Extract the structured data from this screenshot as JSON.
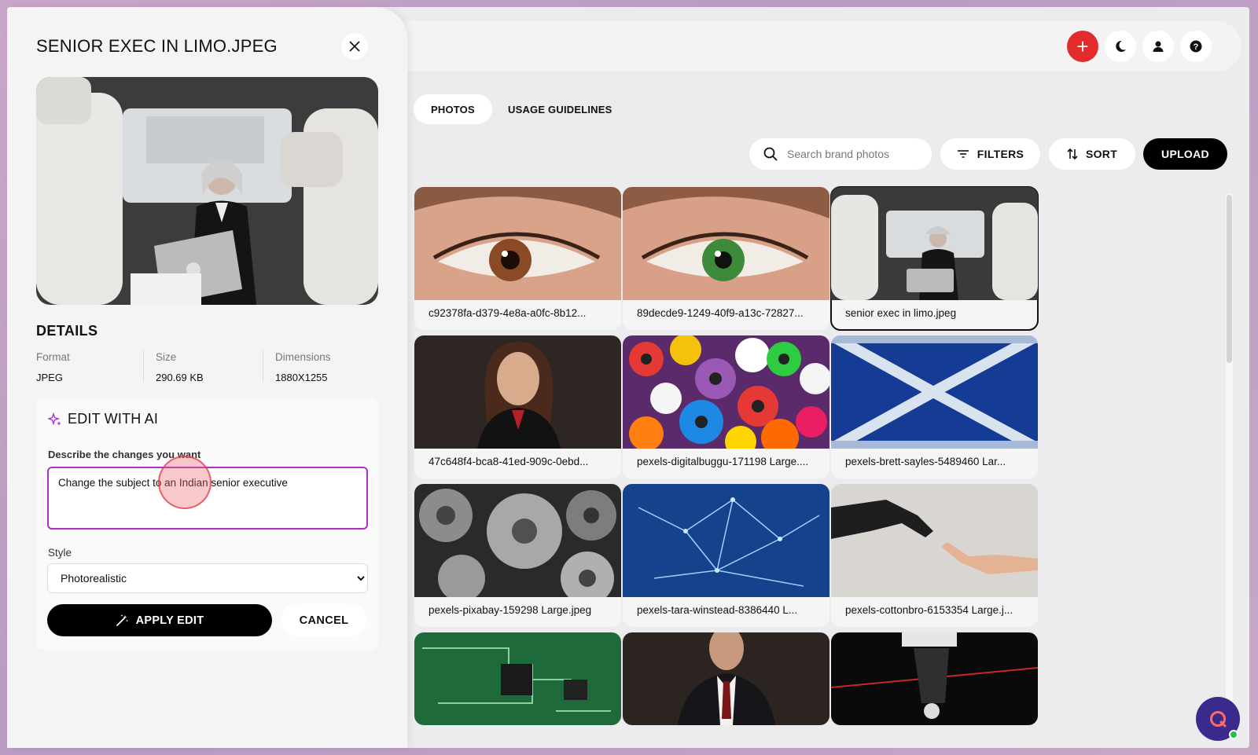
{
  "colors": {
    "accent_red": "#e32b2b",
    "ai_purple": "#b12fc7",
    "chat_purple": "#3a2a8c",
    "online_green": "#21c24a"
  },
  "header": {
    "add_icon": "plus-icon",
    "theme_icon": "moon-icon",
    "user_icon": "user-icon",
    "help_icon": "question-icon"
  },
  "tabs": [
    {
      "label": "PHOTOS",
      "active": true
    },
    {
      "label": "USAGE GUIDELINES",
      "active": false
    }
  ],
  "toolbar": {
    "search_placeholder": "Search brand photos",
    "filters_label": "FILTERS",
    "sort_label": "SORT",
    "upload_label": "UPLOAD"
  },
  "photos": [
    {
      "name": "c92378fa-d379-4e8a-a0fc-8b12...",
      "selected": false
    },
    {
      "name": "89decde9-1249-40f9-a13c-72827...",
      "selected": false
    },
    {
      "name": "senior exec in limo.jpeg",
      "selected": true
    },
    {
      "name": "47c648f4-bca8-41ed-909c-0ebd...",
      "selected": false
    },
    {
      "name": "pexels-digitalbuggu-171198 Large....",
      "selected": false
    },
    {
      "name": "pexels-brett-sayles-5489460 Lar...",
      "selected": false
    },
    {
      "name": "pexels-pixabay-159298 Large.jpeg",
      "selected": false
    },
    {
      "name": "pexels-tara-winstead-8386440 L...",
      "selected": false
    },
    {
      "name": "pexels-cottonbro-6153354 Large.j...",
      "selected": false
    }
  ],
  "panel": {
    "title": "SENIOR EXEC IN LIMO.JPEG",
    "details_heading": "DETAILS",
    "meta": {
      "format_label": "Format",
      "format_value": "JPEG",
      "size_label": "Size",
      "size_value": "290.69 KB",
      "dimensions_label": "Dimensions",
      "dimensions_value": "1880X1255"
    },
    "ai": {
      "heading": "EDIT WITH AI",
      "prompt_label": "Describe the changes you want",
      "prompt_value": "Change the subject to an Indian senior executive",
      "style_label": "Style",
      "style_value": "Photorealistic",
      "apply_label": "APPLY EDIT",
      "cancel_label": "CANCEL"
    }
  }
}
